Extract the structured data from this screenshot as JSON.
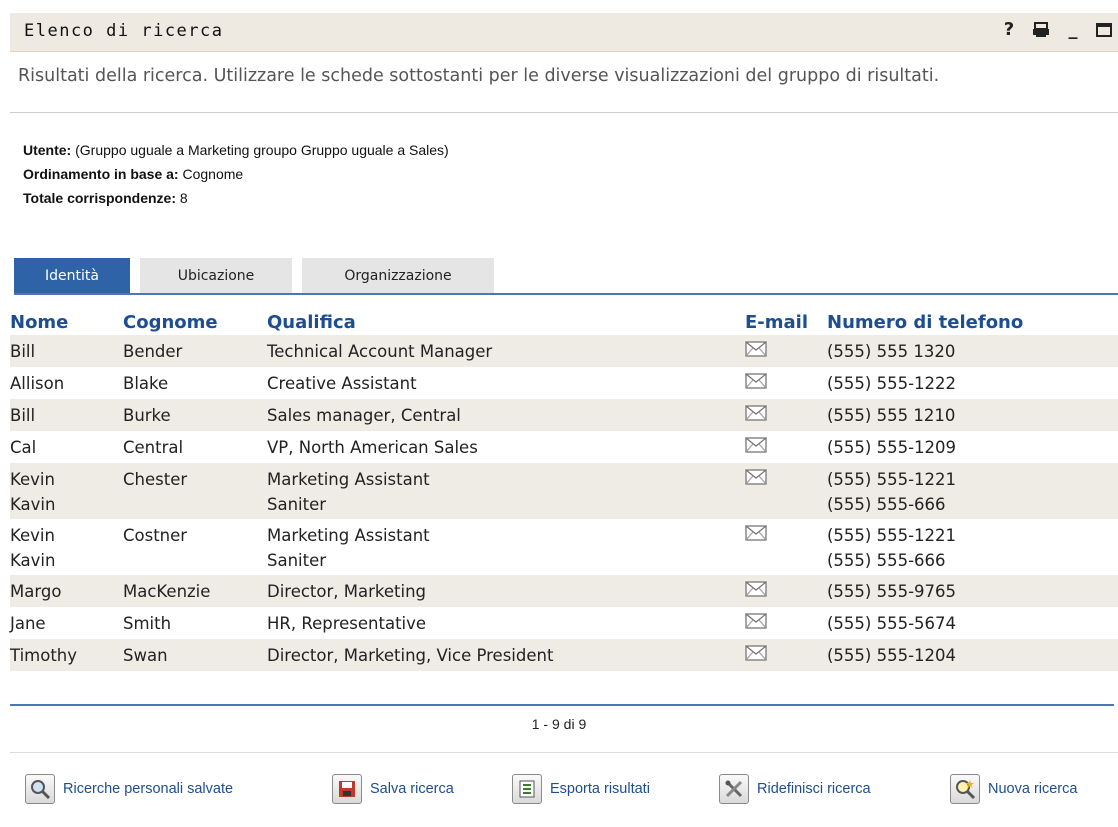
{
  "window": {
    "title": "Elenco di ricerca",
    "help": "?",
    "minimize": "_"
  },
  "intro": "Risultati della ricerca. Utilizzare le schede sottostanti per le diverse visualizzazioni del gruppo di risultati.",
  "meta": {
    "user_label": "Utente:",
    "user_value": "(Gruppo uguale a Marketing groupo Gruppo uguale a Sales)",
    "sort_label": "Ordinamento in base a:",
    "sort_value": "Cognome",
    "total_label": "Totale corrispondenze:",
    "total_value": "8"
  },
  "tabs": [
    "Identità",
    "Ubicazione",
    "Organizzazione"
  ],
  "active_tab": "Identità",
  "columns": [
    "Nome",
    "Cognome",
    "Qualifica",
    "E-mail",
    "Numero di telefono"
  ],
  "rows": [
    {
      "nome": "Bill",
      "cognome": "Bender",
      "qualifica": "Technical Account Manager",
      "email": true,
      "telefono": "(555) 555 1320"
    },
    {
      "nome": "Allison",
      "cognome": "Blake",
      "qualifica": "Creative Assistant",
      "email": true,
      "telefono": "(555) 555-1222"
    },
    {
      "nome": "Bill",
      "cognome": "Burke",
      "qualifica": "Sales manager, Central",
      "email": true,
      "telefono": "(555) 555 1210"
    },
    {
      "nome": "Cal",
      "cognome": "Central",
      "qualifica": "VP, North American Sales",
      "email": true,
      "telefono": "(555) 555-1209"
    },
    {
      "nome": "Kevin",
      "nome2": "Kavin",
      "cognome": "Chester",
      "qualifica": "Marketing Assistant",
      "qualifica2": "Saniter",
      "email": true,
      "telefono": "(555) 555-1221",
      "telefono2": "(555) 555-666"
    },
    {
      "nome": "Kevin",
      "nome2": "Kavin",
      "cognome": "Costner",
      "qualifica": "Marketing Assistant",
      "qualifica2": "Saniter",
      "email": true,
      "telefono": "(555) 555-1221",
      "telefono2": "(555) 555-666"
    },
    {
      "nome": "Margo",
      "cognome": "MacKenzie",
      "qualifica": "Director, Marketing",
      "email": true,
      "telefono": "(555) 555-9765"
    },
    {
      "nome": "Jane",
      "cognome": "Smith",
      "qualifica": "HR, Representative",
      "email": true,
      "telefono": "(555) 555-5674"
    },
    {
      "nome": "Timothy",
      "cognome": "Swan",
      "qualifica": "Director, Marketing, Vice President",
      "email": true,
      "telefono": "(555) 555-1204"
    }
  ],
  "pager": "1 - 9 di 9",
  "actions": [
    {
      "label": "Ricerche personali salvate",
      "icon": "saved-searches-icon"
    },
    {
      "label": "Salva ricerca",
      "icon": "save-icon"
    },
    {
      "label": "Esporta risultati",
      "icon": "export-icon"
    },
    {
      "label": "Ridefinisci ricerca",
      "icon": "refine-icon"
    },
    {
      "label": "Nuova ricerca",
      "icon": "new-search-icon"
    }
  ]
}
